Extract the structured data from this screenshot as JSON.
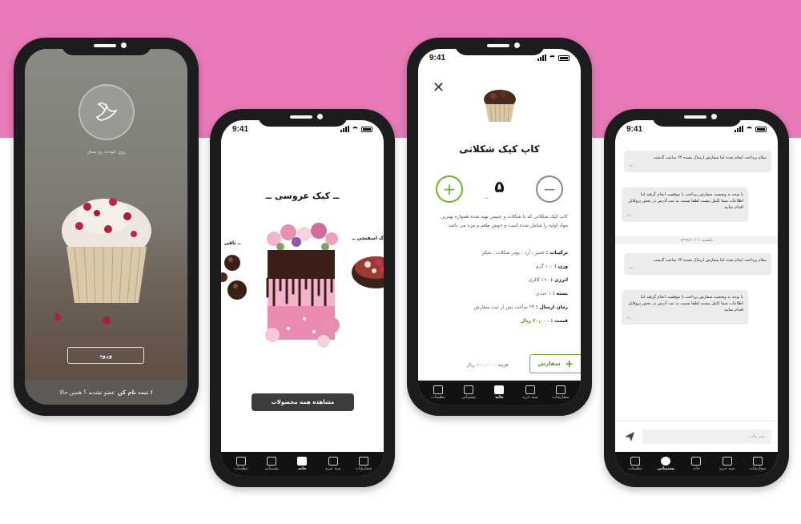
{
  "colors": {
    "brand_pink": "#e87ab8",
    "accent_green": "#6ab22a",
    "nav_dark": "#121212"
  },
  "status_time": "9:41",
  "nav": [
    {
      "label": "سفارشات",
      "icon": "orders-icon"
    },
    {
      "label": "سبد خرید",
      "icon": "cart-icon"
    },
    {
      "label": "خانه",
      "icon": "home-icon"
    },
    {
      "label": "پشتیبانی",
      "icon": "support-icon"
    },
    {
      "label": "تنظیمات",
      "icon": "settings-icon"
    }
  ],
  "login_screen": {
    "tagline": "روز خودت رو بساز",
    "login_button": "ورود",
    "register_prompt": "عضو نشدید ؟ همین حالا",
    "register_link": "ثبت نام کن !"
  },
  "category_screen": {
    "title": "ــ کیک عروسی ــ",
    "left_label": "ــ تافی",
    "right_label": "ک اسفنجی ــ",
    "view_all_button": "مشاهده همه محصولات"
  },
  "product_screen": {
    "close_icon": "close-icon",
    "title": "کاپ کیک شکلاتی",
    "plus": "+",
    "minus": "−",
    "quantity": "۵",
    "quantity_unit": "عدد",
    "description": "کاپ کیک شکلاتی که با شکلات و چیپس تهیه شده همواره بهترین مواد اولیه را شامل شده است و خوش طعم و مزه می باشد.",
    "ingredients_label": "ترکیبات :",
    "ingredients_value": "خمیر ، آرد ، پودر شکلات ، شکر",
    "weight_label": "وزن :",
    "weight_value": "۱۰۰ گرم",
    "energy_label": "انرژی :",
    "energy_value": "۱۶۰ کالری",
    "package_label": "بسته :",
    "package_value": "۱ عددی",
    "delivery_label": "زمان ارسال :",
    "delivery_value": "۲۴ ساعت پس از ثبت سفارش",
    "price_label": "قیمت :",
    "price_value": "۲۰,۰۰۰ ریال",
    "cost_text": "هزینه : ۱۰۰,۰۰۰ ریال",
    "order_button": "سفارش"
  },
  "chat_screen": {
    "messages": [
      {
        "text": "سلام پرداخت انجام شده اما سفارش ارسال نشده ۲۴ ساعت گذشته",
        "time": "۱۲:۰۰"
      },
      {
        "text": "با توجه به وضعیت سفارش پرداخت با موفقیت انجام گرفته اما اطلاعات شما کامل نیست لطفا نسبت به ثبت آدرس در بخش پروفایل اقدام نمایید",
        "time": "۱۲:۰۰"
      },
      {
        "text": "سلام پرداخت انجام شده اما سفارش ارسال نشده ۲۴ ساعت گذشته",
        "time": "۱۲:۰۰"
      },
      {
        "text": "با توجه به وضعیت سفارش پرداخت با موفقیت انجام گرفته اما اطلاعات شما کامل نیست لطفا نسبت به ثبت آدرس در بخش پروفایل اقدام نمایید",
        "time": "۱۲:۰۰"
      }
    ],
    "date_separator": "یکشنبه ۱۳۹۹/۱۰/۰۱",
    "input_placeholder": "متن پیام ..."
  }
}
